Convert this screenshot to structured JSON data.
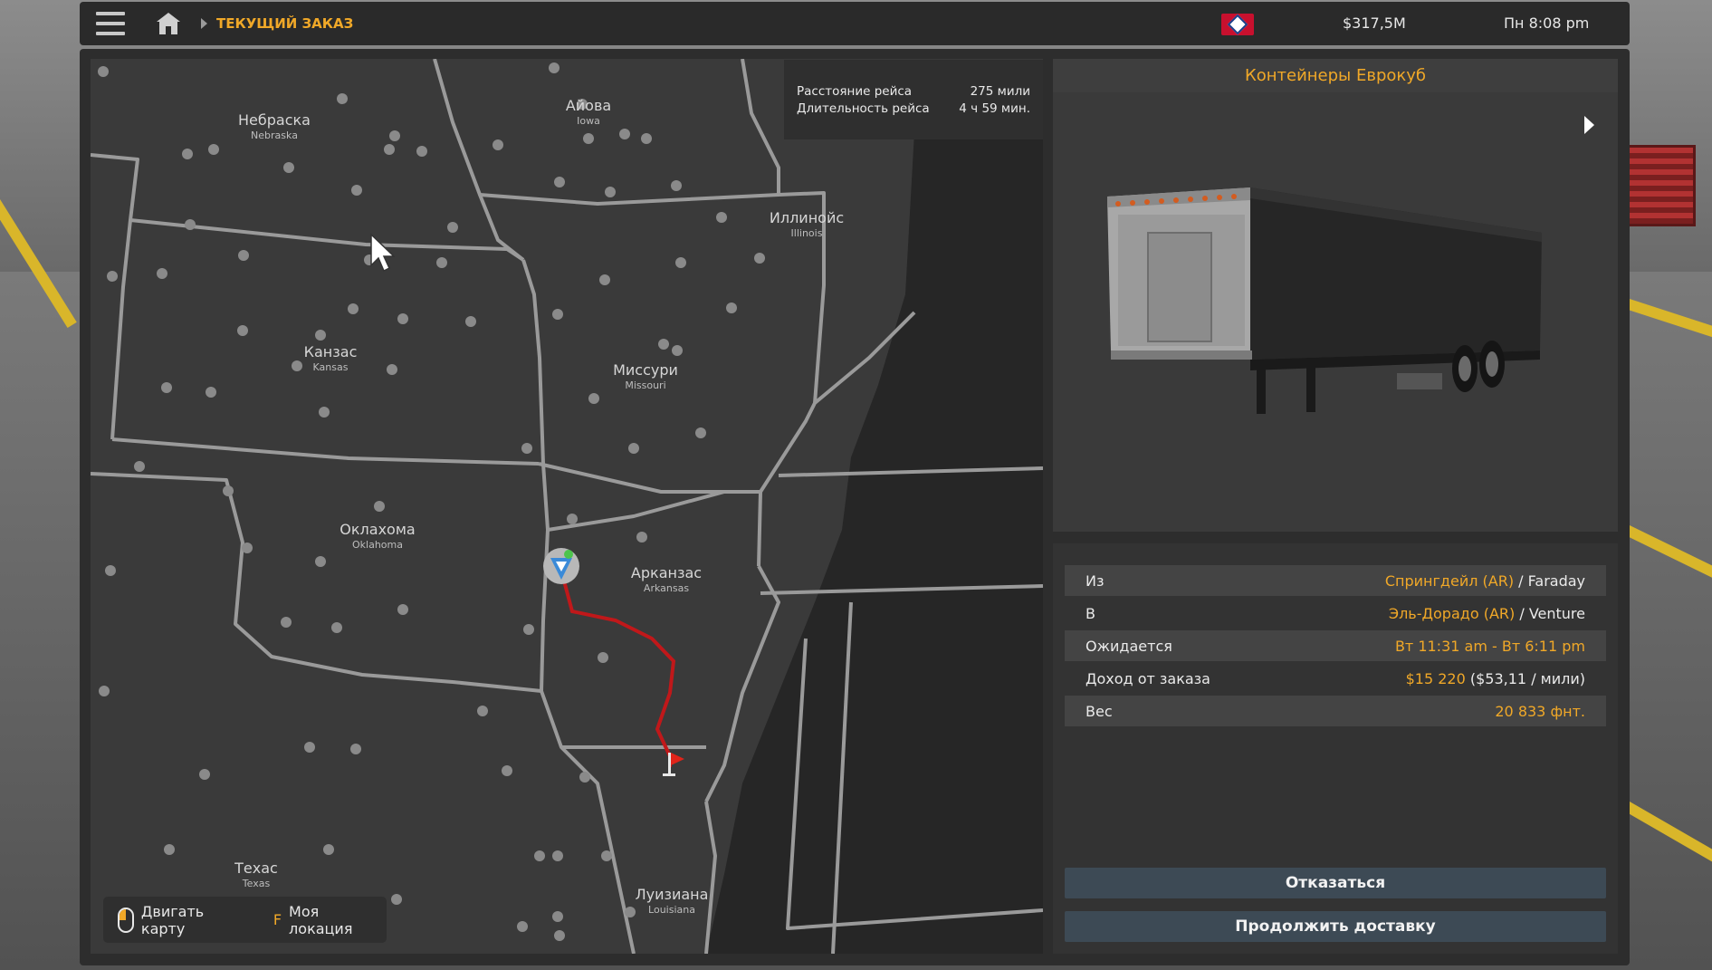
{
  "topbar": {
    "breadcrumb": "ТЕКУЩИЙ ЗАКАЗ",
    "money": "$317,5M",
    "clock": "Пн 8:08 pm"
  },
  "trip": {
    "distance_label": "Расстояние рейса",
    "distance_value": "275 мили",
    "duration_label": "Длительность рейса",
    "duration_value": "4 ч 59 мин."
  },
  "map": {
    "states": [
      {
        "ru": "Небраска",
        "en": "Nebraska"
      },
      {
        "ru": "Айова",
        "en": "Iowa"
      },
      {
        "ru": "Иллинойс",
        "en": "Illinois"
      },
      {
        "ru": "Канзас",
        "en": "Kansas"
      },
      {
        "ru": "Миссури",
        "en": "Missouri"
      },
      {
        "ru": "Оклахома",
        "en": "Oklahoma"
      },
      {
        "ru": "Арканзас",
        "en": "Arkansas"
      },
      {
        "ru": "Техас",
        "en": "Texas"
      },
      {
        "ru": "Луизиана",
        "en": "Louisiana"
      }
    ],
    "hints": {
      "move_map": "Двигать карту",
      "key": "F",
      "my_location": "Моя локация"
    }
  },
  "cargo": {
    "title": "Контейнеры Еврокуб"
  },
  "details": {
    "from_label": "Из",
    "from_city": "Спрингдейл (AR)",
    "from_company": "/ Faraday",
    "to_label": "В",
    "to_city": "Эль-Дорадо (AR)",
    "to_company": "/ Venture",
    "expected_label": "Ожидается",
    "expected_value": "Вт 11:31 am - Вт 6:11 pm",
    "income_label": "Доход от заказа",
    "income_value": "$15 220",
    "income_rate": "($53,11 / мили)",
    "weight_label": "Вес",
    "weight_value": "20 833 фнт."
  },
  "actions": {
    "cancel": "Отказаться",
    "continue": "Продолжить доставку"
  }
}
